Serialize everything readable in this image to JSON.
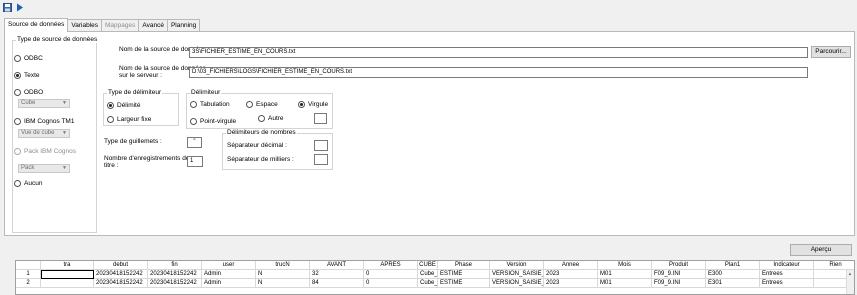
{
  "toolbar": {
    "save_icon": "save-icon",
    "play_icon": "play-icon"
  },
  "tabs": [
    {
      "label": "Source de données",
      "active": true
    },
    {
      "label": "Variables"
    },
    {
      "label": "Mappages",
      "disabled": true
    },
    {
      "label": "Avancé"
    },
    {
      "label": "Planning"
    }
  ],
  "source_type": {
    "title": "Type de source de données",
    "odbc": "ODBC",
    "texte": "Texte",
    "odbo": "ODBO",
    "odbo_combo": "Cube",
    "tm1": "IBM Cognos TM1",
    "tm1_combo": "Vue de cube",
    "pack": "Pack IBM Cognos",
    "pack_combo": "Pack",
    "aucun": "Aucun"
  },
  "source": {
    "name_label": "Nom de la source de données :",
    "name_value": "3S\\FICHIER_ESTIME_EN_COURS.txt",
    "browse_label": "Parcourir...",
    "server_label_line1": "Nom de la source de données",
    "server_label_line2": "sur le serveur :",
    "server_value": "D:\\03_FICHIERS\\LOGS\\FICHIER_ESTIME_EN_COURS.txt"
  },
  "delimiter_type": {
    "title": "Type de délimiteur",
    "delimited": "Délimité",
    "fixed": "Largeur fixe"
  },
  "delimiter": {
    "title": "Délimiteur",
    "tab": "Tabulation",
    "space": "Espace",
    "comma": "Virgule",
    "semicolon": "Point-virgule",
    "other": "Autre"
  },
  "quotes": {
    "label": "Type de guillemets :",
    "value": "\""
  },
  "header_records": {
    "label_line1": "Nombre d'enregistrements de",
    "label_line2": "titre :",
    "value": "1"
  },
  "number_delims": {
    "title": "Délimiteurs de nombres",
    "decimal": "Séparateur décimal :",
    "thousands": "Séparateur de milliers :"
  },
  "preview_label": "Aperçu",
  "grid": {
    "columns": [
      "tra",
      "debut",
      "fin",
      "user",
      "trucN",
      "AVANT",
      "APRES",
      "CUBE",
      "Phase",
      "Version",
      "Annee",
      "Mois",
      "Produit",
      "Plan1",
      "Indicateur",
      "Rien"
    ],
    "rows": [
      {
        "num": "1",
        "cells": [
          "",
          "20230418152242",
          "20230418152242",
          "Admin",
          "N",
          "32",
          "0",
          "Cube_C",
          "ESTIME",
          "VERSION_SAISIE_I",
          "2023",
          "M01",
          "F09_9.INI",
          "E300",
          "Entrees",
          ""
        ]
      },
      {
        "num": "2",
        "cells": [
          "",
          "20230418152242",
          "20230418152242",
          "Admin",
          "N",
          "84",
          "0",
          "Cube_C",
          "ESTIME",
          "VERSION_SAISIE_I",
          "2023",
          "M01",
          "F09_9.INI",
          "E301",
          "Entrees",
          ""
        ]
      }
    ]
  }
}
